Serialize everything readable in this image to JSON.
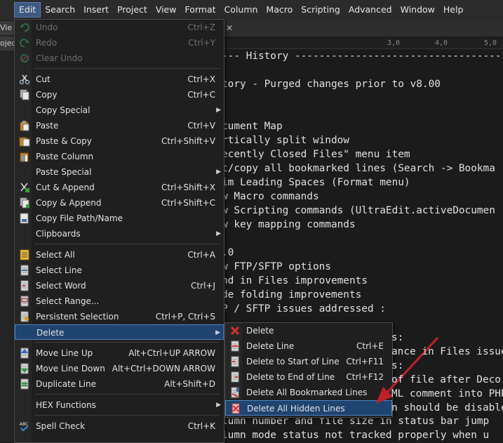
{
  "menubar": [
    "Edit",
    "Search",
    "Insert",
    "Project",
    "View",
    "Format",
    "Column",
    "Macro",
    "Scripting",
    "Advanced",
    "Window",
    "Help"
  ],
  "left_tabs": [
    "Vie",
    "oject"
  ],
  "ruler": [
    "3,0",
    "4,0",
    "5,0"
  ],
  "editor_lines": [
    "--- History ------------------------------------------",
    "",
    "tory - Purged changes prior to v8.00",
    "",
    "",
    "cument Map",
    "rtically split window",
    "ecently Closed Files\" menu item",
    "t/copy all bookmarked lines (Search -> Bookma",
    "im Leading Spaces (Format menu)",
    "w Macro commands",
    "w Scripting commands (UltraEdit.activeDocumen",
    "w key mapping commands",
    "",
    ".0",
    "w FTP/SFTP options",
    "nd in Files improvements",
    "de folding improvements",
    "P / SFTP issues addressed :",
    "",
    "",
    "",
    "",
    "",
    "",
    "",
    "lumn number and file size in status bar jump",
    "lumn mode status not tracked properly when u"
  ],
  "editor_tail": [
    {
      "text": "s:"
    },
    {
      "text": "ance in Files issue"
    },
    {
      "text": "s:"
    },
    {
      "text": "of file after Deco"
    },
    {
      "text": "ML comment into PHP"
    },
    {
      "text": "n should be disable"
    }
  ],
  "edit_menu": [
    {
      "label": "Undo",
      "shortcut": "Ctrl+Z",
      "icon": "undo-icon",
      "disabled": true
    },
    {
      "label": "Redo",
      "shortcut": "Ctrl+Y",
      "icon": "redo-icon",
      "disabled": true
    },
    {
      "label": "Clear Undo",
      "shortcut": "",
      "icon": "clear-undo-icon",
      "disabled": true
    },
    {
      "sep": true
    },
    {
      "label": "Cut",
      "shortcut": "Ctrl+X",
      "icon": "scissors-icon"
    },
    {
      "label": "Copy",
      "shortcut": "Ctrl+C",
      "icon": "copy-icon"
    },
    {
      "label": "Copy Special",
      "shortcut": "",
      "icon": "",
      "submenu": true
    },
    {
      "label": "Paste",
      "shortcut": "Ctrl+V",
      "icon": "paste-icon"
    },
    {
      "label": "Paste & Copy",
      "shortcut": "Ctrl+Shift+V",
      "icon": "paste-copy-icon"
    },
    {
      "label": "Paste Column",
      "shortcut": "",
      "icon": "paste-column-icon"
    },
    {
      "label": "Paste Special",
      "shortcut": "",
      "icon": "",
      "submenu": true
    },
    {
      "label": "Cut & Append",
      "shortcut": "Ctrl+Shift+X",
      "icon": "cut-append-icon"
    },
    {
      "label": "Copy & Append",
      "shortcut": "Ctrl+Shift+C",
      "icon": "copy-append-icon"
    },
    {
      "label": "Copy File Path/Name",
      "shortcut": "",
      "icon": "copy-path-icon"
    },
    {
      "label": "Clipboards",
      "shortcut": "",
      "icon": "",
      "submenu": true
    },
    {
      "sep": true
    },
    {
      "label": "Select All",
      "shortcut": "Ctrl+A",
      "icon": "select-all-icon"
    },
    {
      "label": "Select Line",
      "shortcut": "",
      "icon": "select-line-icon"
    },
    {
      "label": "Select Word",
      "shortcut": "Ctrl+J",
      "icon": "select-word-icon"
    },
    {
      "label": "Select Range...",
      "shortcut": "",
      "icon": "select-range-icon"
    },
    {
      "label": "Persistent Selection",
      "shortcut": "Ctrl+P, Ctrl+S",
      "icon": "persistent-selection-icon"
    },
    {
      "label": "Delete",
      "shortcut": "",
      "icon": "",
      "submenu": true,
      "highlight": true
    },
    {
      "sep": true
    },
    {
      "label": "Move Line Up",
      "shortcut": "Alt+Ctrl+UP ARROW",
      "icon": "move-line-up-icon"
    },
    {
      "label": "Move Line Down",
      "shortcut": "Alt+Ctrl+DOWN ARROW",
      "icon": "move-line-down-icon"
    },
    {
      "label": "Duplicate Line",
      "shortcut": "Alt+Shift+D",
      "icon": "duplicate-line-icon"
    },
    {
      "sep": true
    },
    {
      "label": "HEX Functions",
      "shortcut": "",
      "icon": "",
      "submenu": true
    },
    {
      "sep": true
    },
    {
      "label": "Spell Check",
      "shortcut": "Ctrl+K",
      "icon": "spell-check-icon"
    }
  ],
  "delete_menu": [
    {
      "label": "Delete",
      "shortcut": "",
      "icon": "delete-x-icon"
    },
    {
      "label": "Delete Line",
      "shortcut": "Ctrl+E",
      "icon": "delete-line-icon"
    },
    {
      "label": "Delete to Start of Line",
      "shortcut": "Ctrl+F11",
      "icon": "delete-start-icon"
    },
    {
      "label": "Delete to End of Line",
      "shortcut": "Ctrl+F12",
      "icon": "delete-end-icon"
    },
    {
      "label": "Delete All Bookmarked Lines",
      "shortcut": "",
      "icon": "delete-bookmarked-icon"
    },
    {
      "label": "Delete All Hidden Lines",
      "shortcut": "",
      "icon": "delete-hidden-icon",
      "highlight": true
    }
  ],
  "colors": {
    "highlight": "#1f4470",
    "annotation_arrow": "#c0202a"
  }
}
